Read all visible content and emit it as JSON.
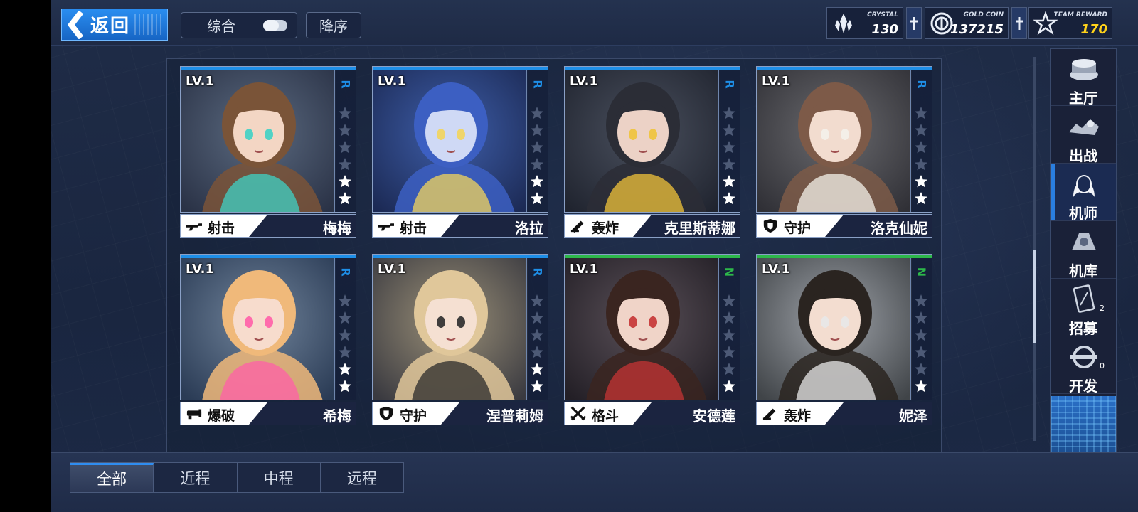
{
  "header": {
    "back_label": "返回",
    "sort_label": "综合",
    "order_label": "降序"
  },
  "resources": {
    "crystal": {
      "name": "CRYSTAL",
      "value": "130",
      "icon": "crystal-icon"
    },
    "gold": {
      "name": "GOLD COIN",
      "value": "137215",
      "icon": "gold-coin-icon"
    },
    "team": {
      "name": "TEAM REWARD",
      "value": "170",
      "icon": "team-reward-star-icon"
    }
  },
  "cards": [
    {
      "level": "LV.1",
      "rarity": "R",
      "role": "射击",
      "role_icon": "rifle-icon",
      "name": "梅梅",
      "stars": 2,
      "max_stars": 6
    },
    {
      "level": "LV.1",
      "rarity": "R",
      "role": "射击",
      "role_icon": "rifle-icon",
      "name": "洛拉",
      "stars": 2,
      "max_stars": 6
    },
    {
      "level": "LV.1",
      "rarity": "R",
      "role": "轰炸",
      "role_icon": "mortar-icon",
      "name": "克里斯蒂娜",
      "stars": 2,
      "max_stars": 6
    },
    {
      "level": "LV.1",
      "rarity": "R",
      "role": "守护",
      "role_icon": "shield-icon",
      "name": "洛克仙妮",
      "stars": 2,
      "max_stars": 6
    },
    {
      "level": "LV.1",
      "rarity": "R",
      "role": "爆破",
      "role_icon": "launcher-icon",
      "name": "希梅",
      "stars": 2,
      "max_stars": 6
    },
    {
      "level": "LV.1",
      "rarity": "R",
      "role": "守护",
      "role_icon": "shield-icon",
      "name": "涅普莉姆",
      "stars": 2,
      "max_stars": 6
    },
    {
      "level": "LV.1",
      "rarity": "N",
      "role": "格斗",
      "role_icon": "crossed-swords-icon",
      "name": "安德莲",
      "stars": 1,
      "max_stars": 6
    },
    {
      "level": "LV.1",
      "rarity": "N",
      "role": "轰炸",
      "role_icon": "mortar-icon",
      "name": "妮泽",
      "stars": 1,
      "max_stars": 6
    }
  ],
  "colors": {
    "rarity_R": "#1e8fe8",
    "rarity_N": "#2db84a",
    "accent": "#2a8df0"
  },
  "sidenav": [
    {
      "label": "主厅",
      "icon": "hall-icon"
    },
    {
      "label": "出战",
      "icon": "battle-icon"
    },
    {
      "label": "机师",
      "icon": "pilot-icon",
      "active": true
    },
    {
      "label": "机库",
      "icon": "hangar-icon"
    },
    {
      "label": "招募",
      "icon": "recruit-card-icon",
      "badge": "2"
    },
    {
      "label": "开发",
      "icon": "develop-wrench-icon",
      "badge": "0"
    }
  ],
  "tabs": [
    {
      "label": "全部",
      "active": true
    },
    {
      "label": "近程"
    },
    {
      "label": "中程"
    },
    {
      "label": "远程"
    }
  ]
}
